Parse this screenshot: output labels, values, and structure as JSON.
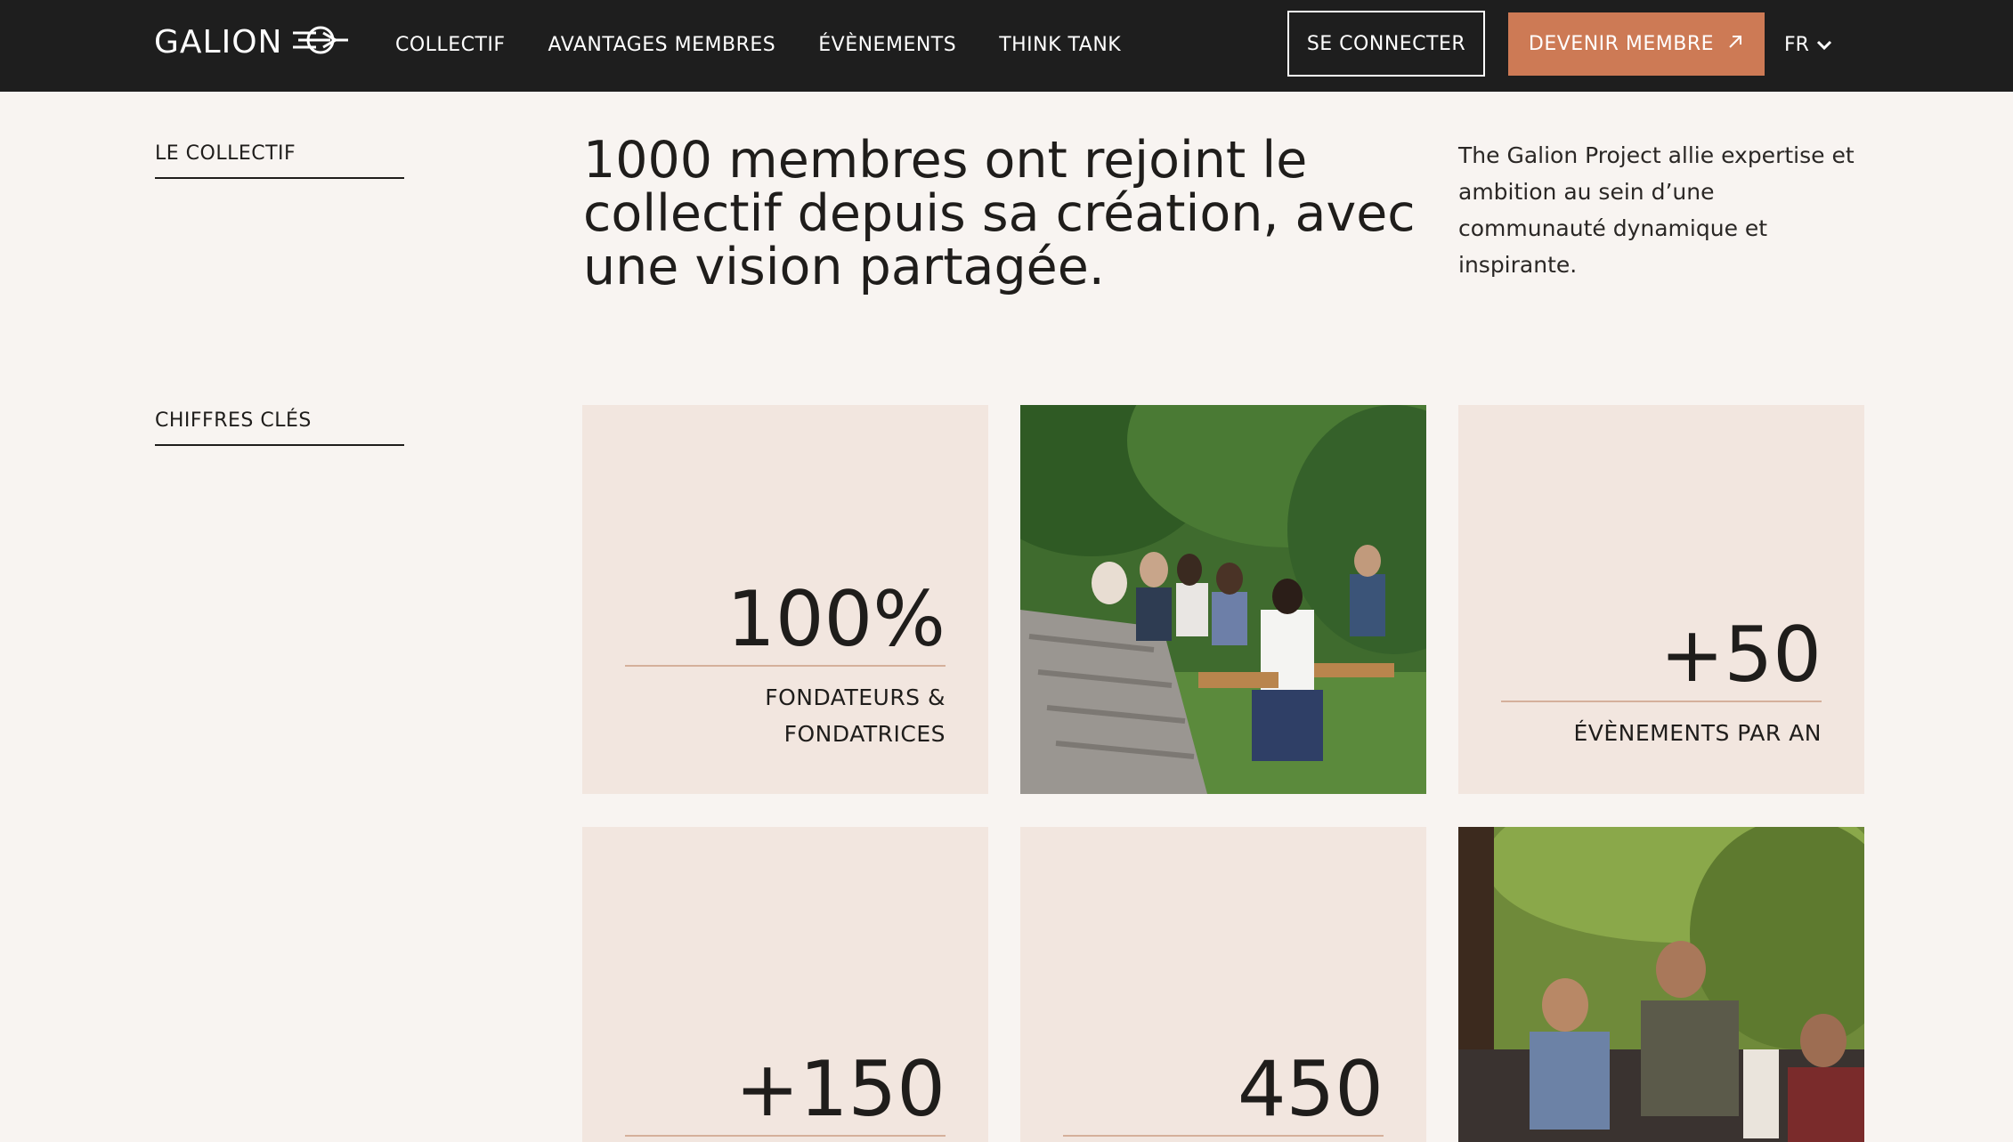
{
  "nav": {
    "logo_text": "GALION",
    "links": [
      "COLLECTIF",
      "AVANTAGES MEMBRES",
      "ÉVÈNEMENTS",
      "THINK TANK"
    ],
    "login_label": "SE CONNECTER",
    "member_label": "DEVENIR MEMBRE",
    "lang_label": "FR"
  },
  "sections": {
    "collectif_label": "LE COLLECTIF",
    "key_figures_label": "CHIFFRES CLÉS"
  },
  "headline": "1000 membres ont rejoint le collectif depuis sa création, avec une vision partagée.",
  "intro": "The Galion Project allie expertise et ambition au sein d’une communauté dynamique et inspirante.",
  "stats": [
    {
      "value": "100%",
      "label_line1": "FONDATEURS &",
      "label_line2": "FONDATRICES"
    },
    {
      "value": "+50",
      "label_line1": "ÉVÈNEMENTS PAR AN"
    },
    {
      "value": "+150"
    },
    {
      "value": "450"
    }
  ],
  "colors": {
    "nav_bg": "#1e1e1e",
    "accent": "#cd7a55",
    "page_bg": "#f8f4f1",
    "card_bg": "#f2e6df"
  },
  "icons": [
    "galion-logo-icon",
    "arrow-up-right-icon",
    "chevron-down-icon"
  ]
}
